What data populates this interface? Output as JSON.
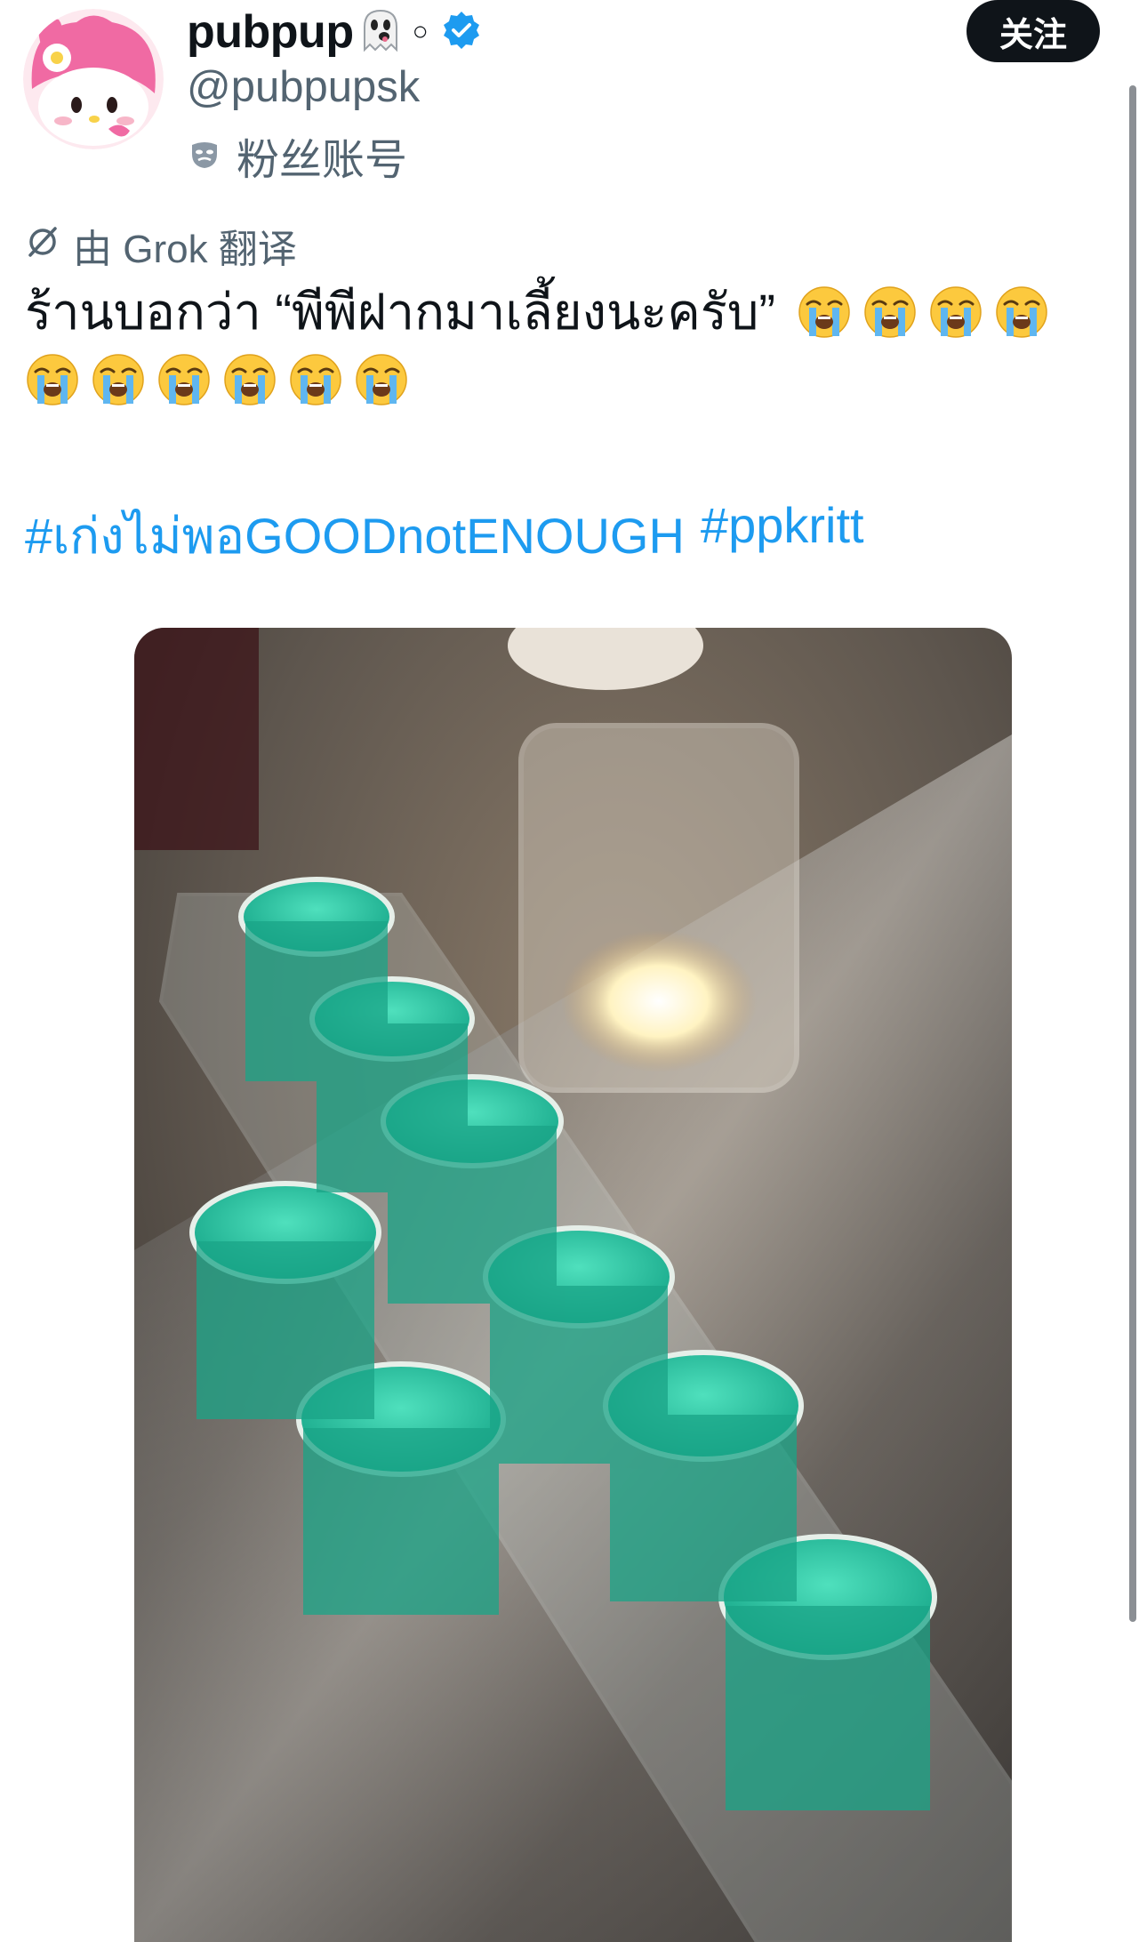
{
  "author": {
    "display_name": "pubpup",
    "handle": "@pubpupsk",
    "account_type": "粉丝账号",
    "verified": true,
    "avatar_icon": "my-melody-avatar"
  },
  "follow_button": {
    "label": "关注"
  },
  "translation": {
    "label": "由 Grok 翻译",
    "icon": "grok-icon"
  },
  "tweet": {
    "text": "ร้านบอกว่า “พีพีฝากมาเลี้ยงนะครับ”",
    "emoji_line1_count": 4,
    "emoji_line2_count": 6,
    "emoji_icon": "loudly-crying-face-icon",
    "hashtags": [
      "#เก่งไม่พอGOODnotENOUGH",
      "#ppkritt"
    ]
  },
  "media": {
    "icon": "photo-shot-glasses"
  },
  "colors": {
    "link": "#1d9bf0",
    "verified": "#1d9bf0",
    "button_bg": "#0f1419",
    "muted": "#536471"
  }
}
